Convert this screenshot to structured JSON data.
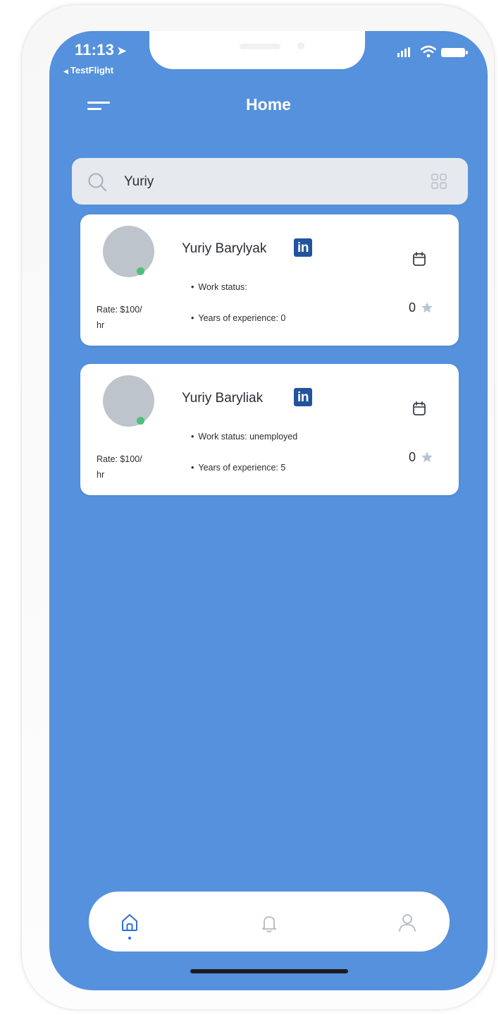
{
  "status_bar": {
    "time": "11:13",
    "back_app": "TestFlight"
  },
  "header": {
    "title": "Home",
    "menu_icon": "menu-icon"
  },
  "search": {
    "value": "Yuriy",
    "icons": [
      "search-icon",
      "grid-icon"
    ]
  },
  "results": [
    {
      "name": "Yuriy Barylyak",
      "rate_line1": "Rate: $100/",
      "rate_line2": "hr",
      "work_status": "Work status:",
      "experience": "Years of experience: 0",
      "score": "0",
      "online": true
    },
    {
      "name": "Yuriy Baryliak",
      "rate_line1": "Rate: $100/",
      "rate_line2": "hr",
      "work_status": "Work status: unemployed",
      "experience": "Years of experience: 5",
      "score": "0",
      "online": true
    }
  ],
  "linkedin_label": "in",
  "tabbar": {
    "tabs": [
      "home",
      "notifications",
      "profile"
    ],
    "active_tab": "home"
  },
  "colors": {
    "background": "#5591dc",
    "card": "#ffffff",
    "search_bg": "#e6e9ee",
    "linkedin": "#23539c",
    "online": "#4bc07a",
    "star": "#b8c4d6"
  }
}
